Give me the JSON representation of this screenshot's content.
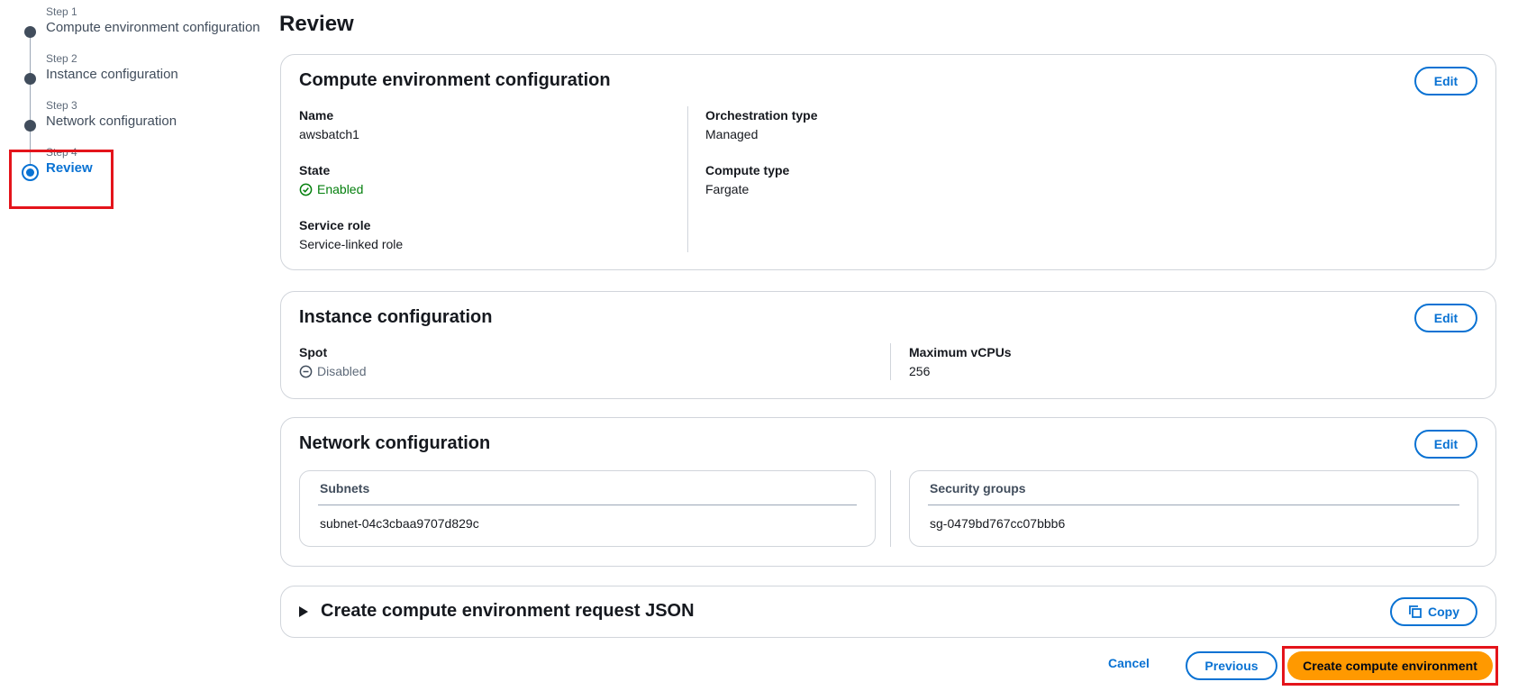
{
  "stepper": {
    "steps": [
      {
        "number": "Step 1",
        "title": "Compute environment configuration"
      },
      {
        "number": "Step 2",
        "title": "Instance configuration"
      },
      {
        "number": "Step 3",
        "title": "Network configuration"
      },
      {
        "number": "Step 4",
        "title": "Review"
      }
    ],
    "active_step": "Step 4"
  },
  "page": {
    "title": "Review"
  },
  "compute_env": {
    "title": "Compute environment configuration",
    "edit_label": "Edit",
    "name_label": "Name",
    "name_value": "awsbatch1",
    "state_label": "State",
    "state_value": "Enabled",
    "service_role_label": "Service role",
    "service_role_value": "Service-linked role",
    "orchestration_label": "Orchestration type",
    "orchestration_value": "Managed",
    "compute_type_label": "Compute type",
    "compute_type_value": "Fargate"
  },
  "instance_config": {
    "title": "Instance configuration",
    "edit_label": "Edit",
    "spot_label": "Spot",
    "spot_value": "Disabled",
    "max_vcpus_label": "Maximum vCPUs",
    "max_vcpus_value": "256"
  },
  "network_config": {
    "title": "Network configuration",
    "edit_label": "Edit",
    "subnets_label": "Subnets",
    "subnets_value": "subnet-04c3cbaa9707d829c",
    "security_groups_label": "Security groups",
    "security_groups_value": "sg-0479bd767cc07bbb6"
  },
  "json_request": {
    "title": "Create compute environment request JSON",
    "copy_label": "Copy"
  },
  "footer": {
    "cancel_label": "Cancel",
    "previous_label": "Previous",
    "create_label": "Create compute environment"
  },
  "colors": {
    "accent": "#0972d3",
    "primary_button": "#ff9900",
    "success": "#037f0c",
    "highlight": "#e4141b"
  },
  "icons": {
    "state": "check-circle-icon",
    "spot": "minus-circle-icon",
    "copy": "copy-icon",
    "expand": "caret-right-icon"
  }
}
